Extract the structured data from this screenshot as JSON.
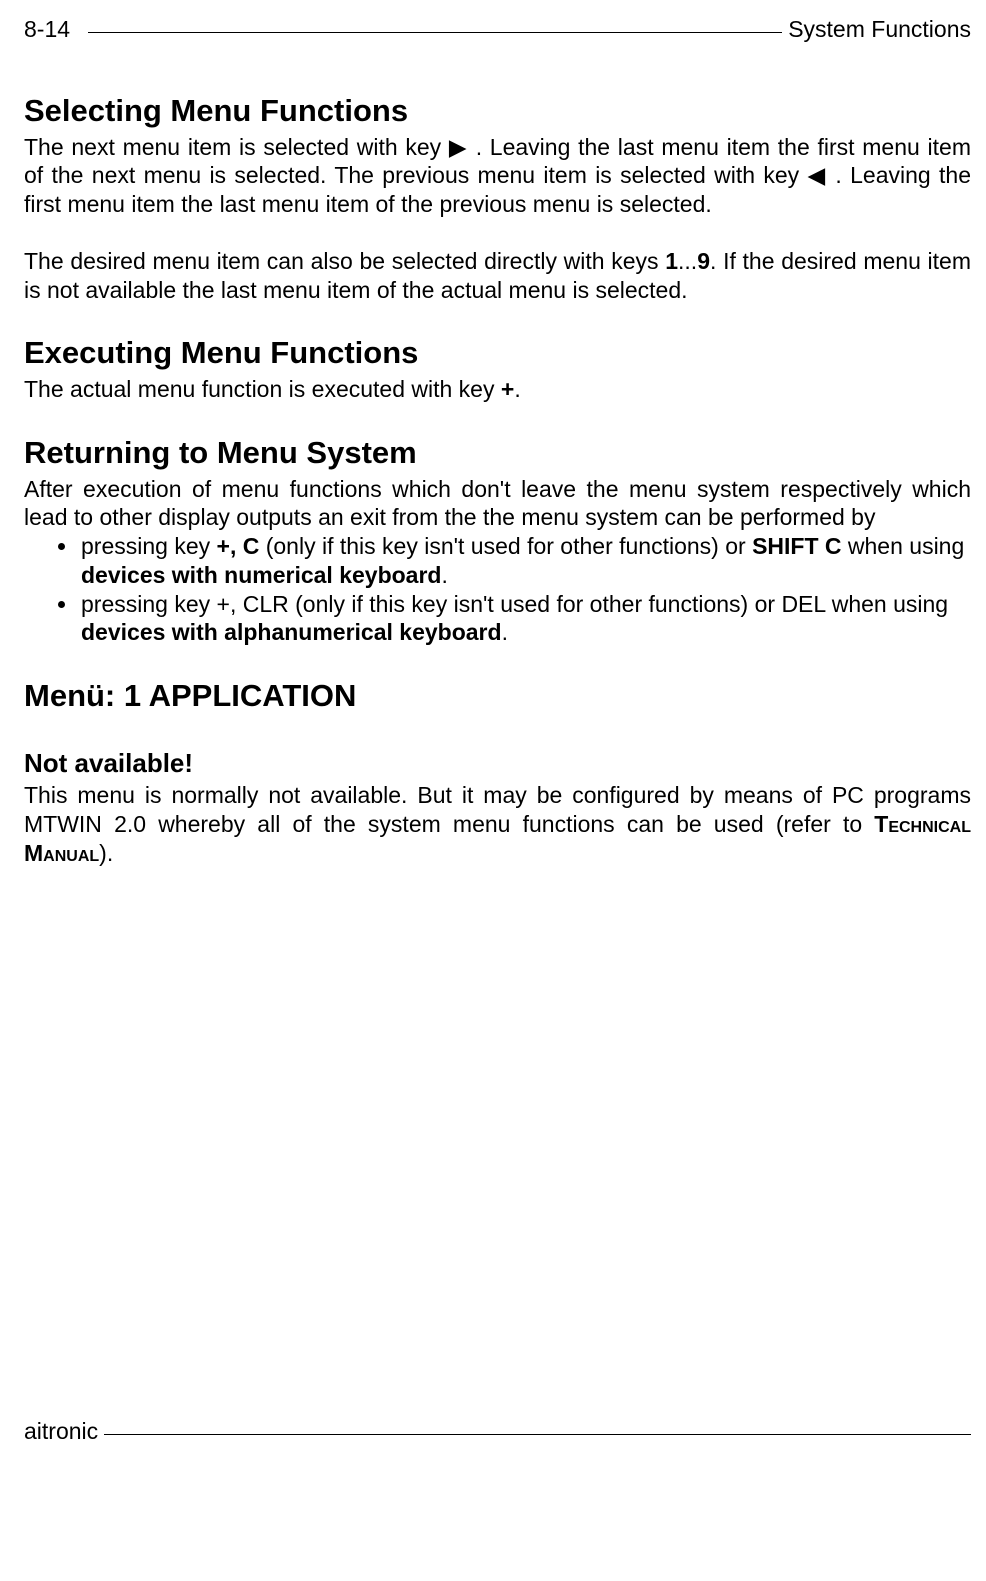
{
  "header": {
    "page_number": "8-14",
    "right": "System Functions"
  },
  "s1": {
    "title": "Selecting Menu Functions",
    "p1a": "The next menu item is selected with key ",
    "p1b": ". Leaving the last menu item the first menu item of the next menu is selected. The previous menu item is selected with key ",
    "p1c": ". Leaving the first menu item the last menu item of the previous menu is selected.",
    "p2a": "The desired menu item can also be selected directly with keys ",
    "p2b": "1",
    "p2c": "...",
    "p2d": "9",
    "p2e": ". If the desired menu item is not available the last menu item of the actual menu is selected."
  },
  "s2": {
    "title": "Executing Menu Functions",
    "p1a": "The actual menu function is executed with key ",
    "p1b": "+",
    "p1c": "."
  },
  "s3": {
    "title": "Returning to Menu System",
    "p1": "After execution of menu functions which don't leave the menu system respectively which lead to other display outputs an exit from the the menu system can be performed by",
    "li1a": "pressing key ",
    "li1b": "+, C",
    "li1c": " (only if this key isn't used for other functions) or ",
    "li1d": "SHIFT C",
    "li1e": " when using ",
    "li1f": "devices with numerical keyboard",
    "li1g": ".",
    "li2a": "pressing key +, CLR (only if this key isn't used for other functions) or DEL when using ",
    "li2b": "devices with alphanumerical keyboard",
    "li2c": "."
  },
  "s4": {
    "title": "Menü: 1 APPLICATION",
    "sub": "Not available!",
    "p1a": "This menu is normally not available. But it may be configured by means of PC programs MTWIN 2.0 whereby all of the system menu functions can be used (refer to ",
    "p1b": "Technical Manual",
    "p1c": ")."
  },
  "footer": {
    "left": "aitronic"
  },
  "icons": {
    "right": "▶",
    "left": "◀"
  }
}
